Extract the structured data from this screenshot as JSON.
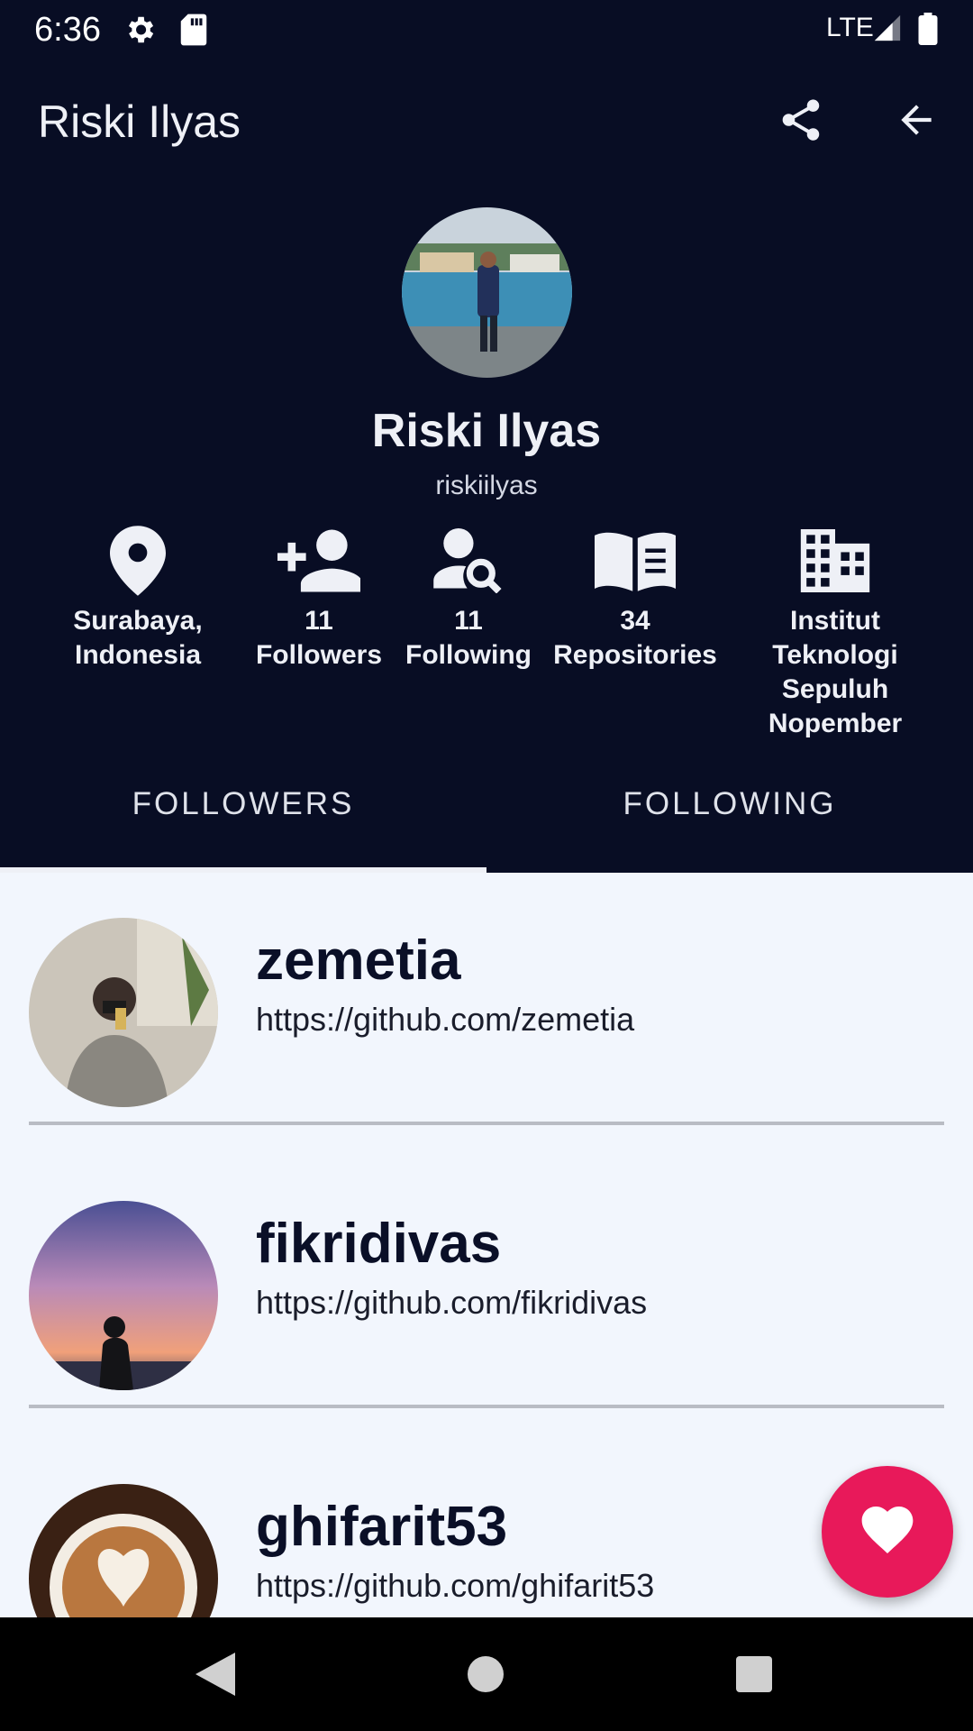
{
  "status_bar": {
    "time": "6:36",
    "network": "LTE",
    "icons": [
      "settings-icon",
      "sd-card-icon",
      "signal-icon",
      "battery-icon"
    ]
  },
  "app_bar": {
    "title": "Riski Ilyas",
    "actions": [
      "share-icon",
      "back-arrow-icon"
    ]
  },
  "profile": {
    "name": "Riski Ilyas",
    "username": "riskiilyas",
    "stats": [
      {
        "icon": "location-pin-icon",
        "line1": "Surabaya,",
        "line2": "Indonesia"
      },
      {
        "icon": "person-add-icon",
        "line1": "11",
        "line2": "Followers"
      },
      {
        "icon": "person-search-icon",
        "line1": "11",
        "line2": "Following"
      },
      {
        "icon": "book-icon",
        "line1": "34",
        "line2": "Repositories"
      },
      {
        "icon": "building-icon",
        "line1": "Institut",
        "line2": "Teknologi",
        "line3": "Sepuluh",
        "line4": "Nopember"
      }
    ]
  },
  "tabs": [
    {
      "label": "FOLLOWERS",
      "selected": true
    },
    {
      "label": "FOLLOWING",
      "selected": false
    }
  ],
  "users": [
    {
      "name": "zemetia",
      "url": "https://github.com/zemetia"
    },
    {
      "name": "fikridivas",
      "url": "https://github.com/fikridivas"
    },
    {
      "name": "ghifarit53",
      "url": "https://github.com/ghifarit53"
    }
  ],
  "fab": {
    "icon": "heart-icon"
  },
  "colors": {
    "header_bg": "#080d24",
    "list_bg": "#f2f6fd",
    "fab": "#e8195a",
    "text_dark": "#0a0f27"
  },
  "nav_bar": {
    "buttons": [
      "back-triangle-icon",
      "home-circle-icon",
      "recents-square-icon"
    ]
  }
}
